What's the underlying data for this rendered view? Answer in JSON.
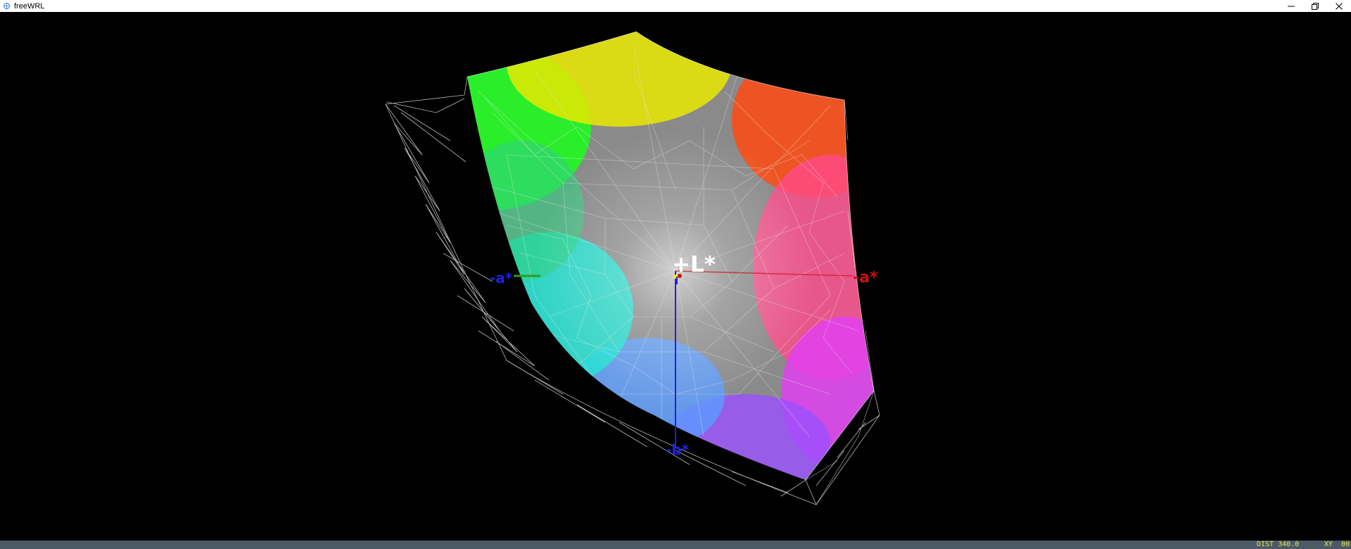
{
  "window": {
    "title": "freeWRL",
    "controls": [
      "minimize-icon",
      "restore-icon",
      "close-icon"
    ]
  },
  "scene": {
    "axis_labels": {
      "plus_l": "+L*",
      "plus_a": "-a*",
      "minus_a": "-a*",
      "minus_b": "-b*"
    },
    "colors": {
      "background": "#000000",
      "plus_l_label": "#ffffff",
      "plus_a_label": "#d01010",
      "minus_a_label": "#2020e0",
      "minus_b_label": "#2020e0",
      "wireframe": "#ffffff"
    }
  },
  "status": {
    "dist": "DIST 340.0",
    "mode": "XY  00"
  }
}
